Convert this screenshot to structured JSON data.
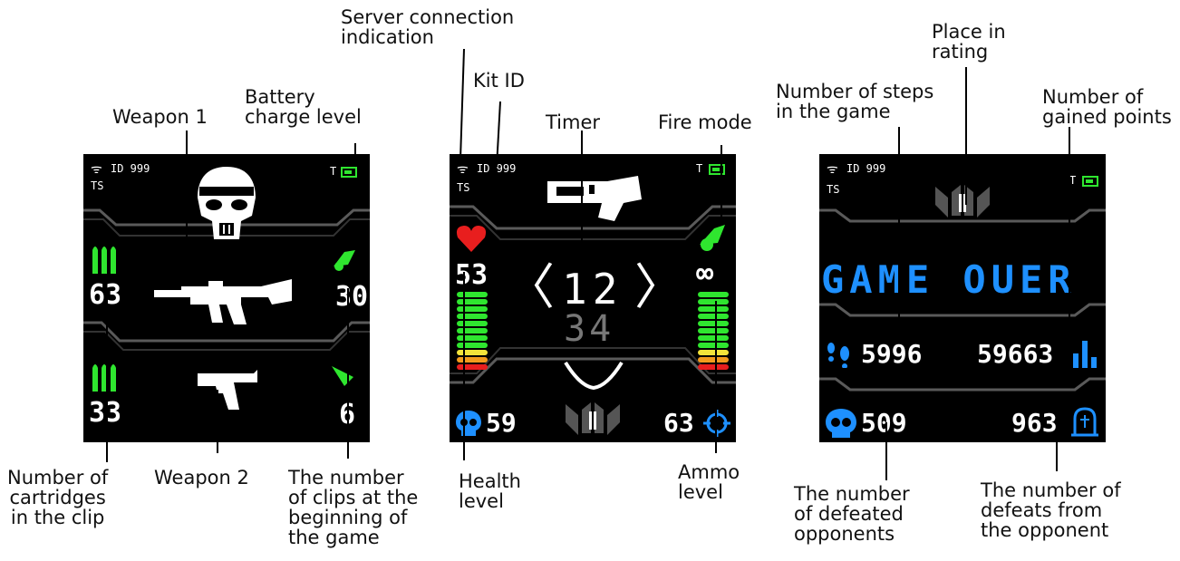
{
  "colors": {
    "screen": "#000000",
    "green": "#2fe62f",
    "blue": "#1e90ff",
    "red": "#e81e1e",
    "frame": "#5a5a5a"
  },
  "labels": {
    "server_connection": [
      "Server connection",
      "indication"
    ],
    "kit_id": "Kit ID",
    "timer": "Timer",
    "fire_mode": "Fire mode",
    "weapon1": "Weapon 1",
    "battery": [
      "Battery",
      "charge level"
    ],
    "place_rating": [
      "Place in",
      "rating"
    ],
    "steps": [
      "Number of steps",
      "in the game"
    ],
    "gained_points": [
      "Number of",
      "gained points"
    ],
    "cartridges": [
      "Number of",
      "cartridges",
      "in the clip"
    ],
    "weapon2": "Weapon 2",
    "clips": [
      "The number",
      "of clips at the",
      "beginning of",
      "the game"
    ],
    "health": [
      "Health",
      "level"
    ],
    "ammo": [
      "Ammo",
      "level"
    ],
    "defeated": [
      "The number",
      "of defeated",
      "opponents"
    ],
    "defeats_from": [
      "The number of",
      "defeats from",
      "the opponent"
    ]
  },
  "screen1": {
    "id_text": "ID 999",
    "ts": "TS",
    "t": "T",
    "cartridges1": "63",
    "clips1": "30",
    "cartridges2": "33",
    "clips2": "6"
  },
  "screen2": {
    "id_text": "ID 999",
    "ts": "TS",
    "t": "T",
    "health": "53",
    "ammo_symbol": "∞",
    "timer_top": "12",
    "timer_bottom": "34",
    "defeated": "59",
    "ammo": "63",
    "health_bars": [
      "green",
      "green",
      "green",
      "green",
      "green",
      "green",
      "green",
      "green",
      "yellow",
      "orange",
      "red"
    ],
    "ammo_bars": [
      "green",
      "green",
      "green",
      "green",
      "green",
      "green",
      "green",
      "green",
      "yellow",
      "orange",
      "red"
    ]
  },
  "screen3": {
    "id_text": "ID 999",
    "ts": "TS",
    "t": "T",
    "game_over": "GAME OUER",
    "steps": "5996",
    "points": "59663",
    "defeated": "509",
    "defeats_from": "963"
  }
}
